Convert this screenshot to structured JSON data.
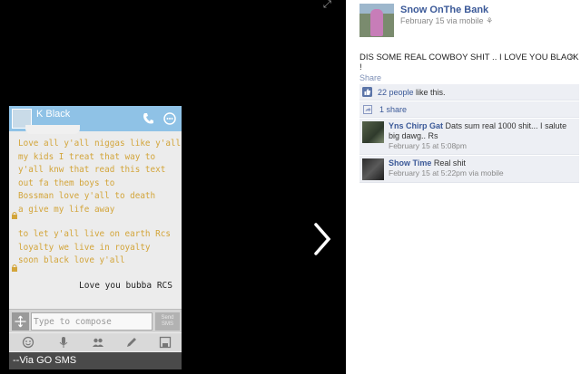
{
  "photo": {
    "contact_name": "K Black",
    "message_1_lines": "Love all y'all niggas like y'all\nmy kids I treat that way to\ny'all knw that read this text\nout fa them boys to\nBossman love y'all to death\na give my life away",
    "message_2_lines": "to let y'all live on earth Rcs\nloyalty we live in royalty\nsoon black love y'all",
    "sent_message": "Love you bubba RCS",
    "compose_placeholder": "Type to compose",
    "send_label": "Send\nSMS",
    "footer": "--Via GO SMS",
    "icons": [
      "expand-icon",
      "next-arrow-icon",
      "phone-call-icon",
      "message-icon",
      "lock-icon",
      "attach-icon",
      "emoji-icon",
      "microphone-icon",
      "group-icon",
      "edit-icon",
      "save-icon"
    ]
  },
  "post": {
    "poster_name": "Snow OnThe Bank",
    "meta": "February 15 via mobile",
    "text": "DIS SOME REAL COWBOY SHIT .. I LOVE YOU BLACK !",
    "close_label": "×",
    "share_label": "Share",
    "likes_count": "22 people",
    "likes_suffix": " like this.",
    "shares_label": "1 share"
  },
  "comments": [
    {
      "name": "Yns Chirp Gat",
      "text": " Dats sum real 1000 shit... I salute big dawg.. Rs",
      "meta": "February 15 at 5:08pm"
    },
    {
      "name": "Show Time",
      "text": " Real shit",
      "meta": "February 15 at 5:22pm via mobile"
    }
  ],
  "colors": {
    "link": "#3b5998",
    "message_text": "#d3a53a",
    "phone_header": "#8fc2e6",
    "feed_bg": "#edeff4"
  }
}
